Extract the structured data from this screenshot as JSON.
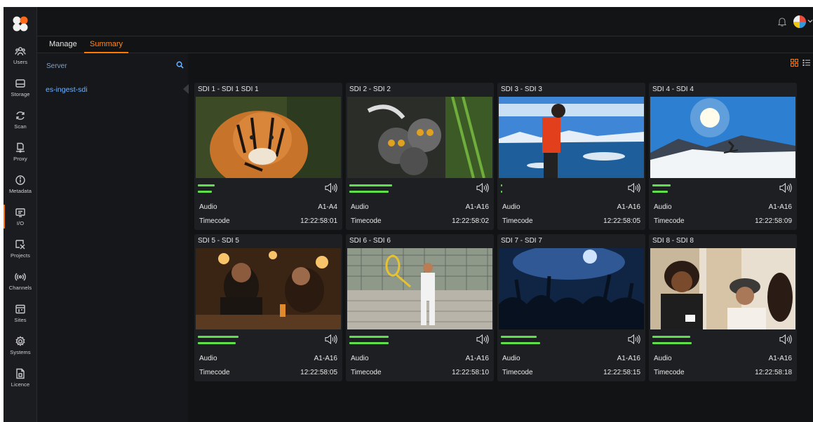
{
  "tabs": {
    "manage": "Manage",
    "summary": "Summary"
  },
  "nav": [
    {
      "label": "Users",
      "icon": "users-icon"
    },
    {
      "label": "Storage",
      "icon": "storage-icon"
    },
    {
      "label": "Scan",
      "icon": "scan-icon"
    },
    {
      "label": "Proxy",
      "icon": "proxy-icon"
    },
    {
      "label": "Metadata",
      "icon": "metadata-icon"
    },
    {
      "label": "I/O",
      "icon": "io-icon",
      "active": true
    },
    {
      "label": "Projects",
      "icon": "projects-icon"
    },
    {
      "label": "Channels",
      "icon": "channels-icon"
    },
    {
      "label": "Sites",
      "icon": "sites-icon"
    },
    {
      "label": "Systems",
      "icon": "systems-icon"
    },
    {
      "label": "Licence",
      "icon": "licence-icon"
    }
  ],
  "search": {
    "placeholder": "Server"
  },
  "servers": [
    "es-ingest-sdi"
  ],
  "labels": {
    "audio": "Audio",
    "timecode": "Timecode"
  },
  "colors": {
    "accent": "#ff7a00",
    "link": "#6fb3ff",
    "meter": "#5fe04a"
  },
  "channels": [
    {
      "title": "SDI 1 - SDI 1 SDI 1",
      "audio": "A1-A4",
      "timecode": "12:22:58:01",
      "levels": [
        0.14,
        0.12
      ],
      "scene": "tiger"
    },
    {
      "title": "SDI 2 - SDI 2",
      "audio": "A1-A16",
      "timecode": "12:22:58:02",
      "levels": [
        0.36,
        0.33
      ],
      "scene": "lemurs"
    },
    {
      "title": "SDI 3 - SDI 3",
      "audio": "A1-A16",
      "timecode": "12:22:58:05",
      "levels": [
        0.01,
        0.01
      ],
      "scene": "glacier"
    },
    {
      "title": "SDI 4 - SDI 4",
      "audio": "A1-A16",
      "timecode": "12:22:58:09",
      "levels": [
        0.15,
        0.13
      ],
      "scene": "skier"
    },
    {
      "title": "SDI 5 - SDI 5",
      "audio": "A1-A16",
      "timecode": "12:22:58:05",
      "levels": [
        0.34,
        0.32
      ],
      "scene": "bar"
    },
    {
      "title": "SDI 6 - SDI 6",
      "audio": "A1-A16",
      "timecode": "12:22:58:10",
      "levels": [
        0.33,
        0.33
      ],
      "scene": "tennis"
    },
    {
      "title": "SDI 7 - SDI 7",
      "audio": "A1-A16",
      "timecode": "12:22:58:15",
      "levels": [
        0.3,
        0.33
      ],
      "scene": "concert"
    },
    {
      "title": "SDI 8 - SDI 8",
      "audio": "A1-A16",
      "timecode": "12:22:58:18",
      "levels": [
        0.32,
        0.33
      ],
      "scene": "cafe"
    }
  ]
}
